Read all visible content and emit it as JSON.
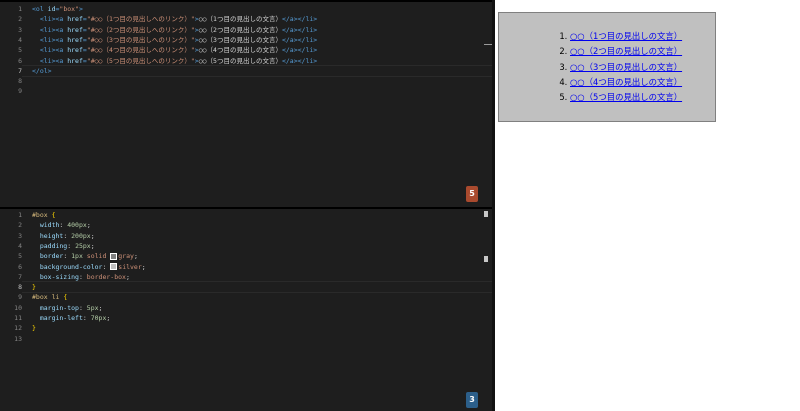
{
  "html_editor": {
    "line_numbers": [
      "1",
      "2",
      "3",
      "4",
      "5",
      "6",
      "7",
      "8",
      "9"
    ],
    "active_line": "7",
    "lines": [
      [
        [
          "tag",
          "<ol "
        ],
        [
          "attr",
          "id"
        ],
        [
          "tag",
          "="
        ],
        [
          "str",
          "\"box\""
        ],
        [
          "tag",
          ">"
        ]
      ],
      [
        [
          "txt",
          "  "
        ],
        [
          "tag",
          "<li><a "
        ],
        [
          "attr",
          "href"
        ],
        [
          "tag",
          "="
        ],
        [
          "str",
          "\"#○○（1つ目の見出しへのリンク）\""
        ],
        [
          "tag",
          ">"
        ],
        [
          "txt",
          "○○（1つ目の見出しの文言）"
        ],
        [
          "tag",
          "</a></li>"
        ]
      ],
      [
        [
          "txt",
          "  "
        ],
        [
          "tag",
          "<li><a "
        ],
        [
          "attr",
          "href"
        ],
        [
          "tag",
          "="
        ],
        [
          "str",
          "\"#○○（2つ目の見出しへのリンク）\""
        ],
        [
          "tag",
          ">"
        ],
        [
          "txt",
          "○○（2つ目の見出しの文言）"
        ],
        [
          "tag",
          "</a></li>"
        ]
      ],
      [
        [
          "txt",
          "  "
        ],
        [
          "tag",
          "<li><a "
        ],
        [
          "attr",
          "href"
        ],
        [
          "tag",
          "="
        ],
        [
          "str",
          "\"#○○（3つ目の見出しへのリンク）\""
        ],
        [
          "tag",
          ">"
        ],
        [
          "txt",
          "○○（3つ目の見出しの文言）"
        ],
        [
          "tag",
          "</a></li>"
        ]
      ],
      [
        [
          "txt",
          "  "
        ],
        [
          "tag",
          "<li><a "
        ],
        [
          "attr",
          "href"
        ],
        [
          "tag",
          "="
        ],
        [
          "str",
          "\"#○○（4つ目の見出しへのリンク）\""
        ],
        [
          "tag",
          ">"
        ],
        [
          "txt",
          "○○（4つ目の見出しの文言）"
        ],
        [
          "tag",
          "</a></li>"
        ]
      ],
      [
        [
          "txt",
          "  "
        ],
        [
          "tag",
          "<li><a "
        ],
        [
          "attr",
          "href"
        ],
        [
          "tag",
          "="
        ],
        [
          "str",
          "\"#○○（5つ目の見出しへのリンク）\""
        ],
        [
          "tag",
          ">"
        ],
        [
          "txt",
          "○○（5つ目の見出しの文言）"
        ],
        [
          "tag",
          "</a></li>"
        ]
      ],
      [
        [
          "tag",
          "</ol>"
        ]
      ],
      [],
      []
    ],
    "language_icon": "html5-icon",
    "language_icon_text": "5"
  },
  "css_editor": {
    "line_numbers": [
      "1",
      "2",
      "3",
      "4",
      "5",
      "6",
      "7",
      "8",
      "9",
      "10",
      "11",
      "12",
      "13"
    ],
    "active_line": "8",
    "lines": [
      [
        [
          "sel",
          "#box "
        ],
        [
          "brace",
          "{"
        ]
      ],
      [
        [
          "txt",
          "  "
        ],
        [
          "prop",
          "width"
        ],
        [
          "txt",
          ": "
        ],
        [
          "num",
          "400px"
        ],
        [
          "txt",
          ";"
        ]
      ],
      [
        [
          "txt",
          "  "
        ],
        [
          "prop",
          "height"
        ],
        [
          "txt",
          ": "
        ],
        [
          "num",
          "200px"
        ],
        [
          "txt",
          ";"
        ]
      ],
      [
        [
          "txt",
          "  "
        ],
        [
          "prop",
          "padding"
        ],
        [
          "txt",
          ": "
        ],
        [
          "num",
          "25px"
        ],
        [
          "txt",
          ";"
        ]
      ],
      [
        [
          "txt",
          "  "
        ],
        [
          "prop",
          "border"
        ],
        [
          "txt",
          ": "
        ],
        [
          "num",
          "1px "
        ],
        [
          "val",
          "solid "
        ],
        [
          "swatch",
          "#808080"
        ],
        [
          "val",
          "gray"
        ],
        [
          "txt",
          ";"
        ]
      ],
      [
        [
          "txt",
          "  "
        ],
        [
          "prop",
          "background-color"
        ],
        [
          "txt",
          ": "
        ],
        [
          "swatch",
          "#c0c0c0"
        ],
        [
          "val",
          "silver"
        ],
        [
          "txt",
          ";"
        ]
      ],
      [
        [
          "txt",
          "  "
        ],
        [
          "prop",
          "box-sizing"
        ],
        [
          "txt",
          ": "
        ],
        [
          "val",
          "border-box"
        ],
        [
          "txt",
          ";"
        ]
      ],
      [
        [
          "brace",
          "}"
        ]
      ],
      [
        [
          "sel",
          "#box li "
        ],
        [
          "brace",
          "{"
        ]
      ],
      [
        [
          "txt",
          "  "
        ],
        [
          "prop",
          "margin-top"
        ],
        [
          "txt",
          ": "
        ],
        [
          "num",
          "5px"
        ],
        [
          "txt",
          ";"
        ]
      ],
      [
        [
          "txt",
          "  "
        ],
        [
          "prop",
          "margin-left"
        ],
        [
          "txt",
          ": "
        ],
        [
          "num",
          "70px"
        ],
        [
          "txt",
          ";"
        ]
      ],
      [
        [
          "brace",
          "}"
        ]
      ],
      []
    ],
    "language_icon": "css3-icon",
    "language_icon_text": "3"
  },
  "preview": {
    "list_items": [
      {
        "label": "○○（1つ目の見出しの文言）",
        "href": "#○○（1つ目の見出しへのリンク）"
      },
      {
        "label": "○○（2つ目の見出しの文言）",
        "href": "#○○（2つ目の見出しへのリンク）"
      },
      {
        "label": "○○（3つ目の見出しの文言）",
        "href": "#○○（3つ目の見出しへのリンク）"
      },
      {
        "label": "○○（4つ目の見出しの文言）",
        "href": "#○○（4つ目の見出しへのリンク）"
      },
      {
        "label": "○○（5つ目の見出しの文言）",
        "href": "#○○（5つ目の見出しへのリンク）"
      }
    ],
    "box_background": "#c0c0c0",
    "box_border": "#808080",
    "link_color": "#0000ee"
  },
  "colors": {
    "editor_bg": "#1e1e1e",
    "tag": "#569cd6",
    "attribute": "#9cdcfe",
    "string": "#ce9178",
    "number": "#b5cea8",
    "selector": "#d7ba7d",
    "brace": "#ffd700",
    "html5_badge": "#a94a2e",
    "css3_badge": "#2c5f8a"
  }
}
